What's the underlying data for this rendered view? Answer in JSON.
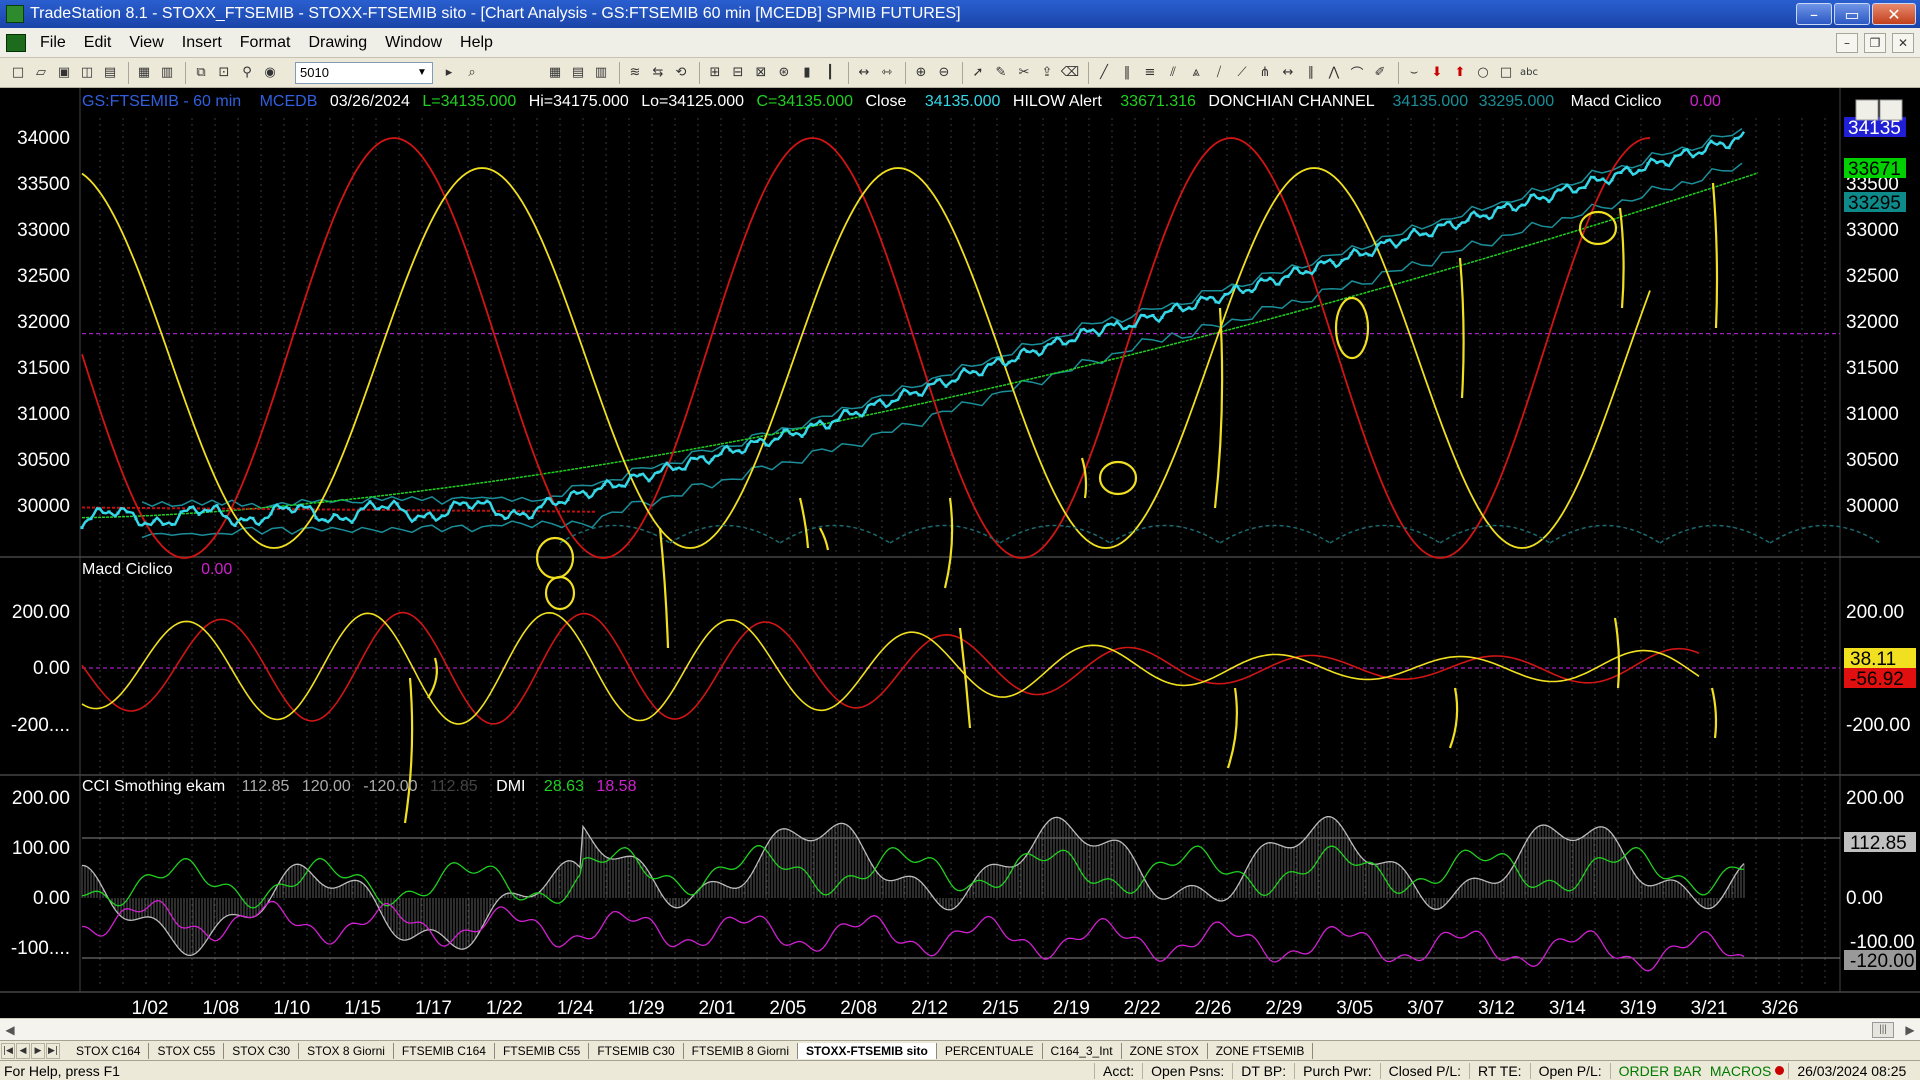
{
  "window": {
    "title": "TradeStation 8.1 - STOXX_FTSEMIB - STOXX-FTSEMIB sito - [Chart Analysis - GS:FTSEMIB  60 min  [MCEDB] SPMIB FUTURES]",
    "minimize": "–",
    "maximize": "▭",
    "close": "✕"
  },
  "menu": {
    "items": [
      "File",
      "Edit",
      "View",
      "Insert",
      "Format",
      "Drawing",
      "Window",
      "Help"
    ],
    "mdi": [
      "–",
      "❐",
      "✕"
    ]
  },
  "toolbar": {
    "symbol_value": "5010"
  },
  "chart": {
    "header": {
      "symbol": "GS:FTSEMIB - 60 min",
      "data": "MCEDB",
      "date": "03/26/2024",
      "last": "L=34135.000",
      "hi": "Hi=34175.000",
      "lo": "Lo=34125.000",
      "close_eq": "C=34135.000",
      "close_lbl": "Close",
      "close_val": "34135.000",
      "hilow_lbl": "HILOW Alert",
      "hilow_val": "33671.316",
      "donch_lbl": "DONCHIAN CHANNEL",
      "donch_hi": "34135.000",
      "donch_lo": "33295.000",
      "macd_lbl": "Macd Ciclico",
      "macd_val": "0.00"
    },
    "price_axis": [
      "34000",
      "33500",
      "33000",
      "32500",
      "32000",
      "31500",
      "31000",
      "30500",
      "30000"
    ],
    "price_axis_right": [
      "33500",
      "33000",
      "32500",
      "32000",
      "31500",
      "31000",
      "30500",
      "30000"
    ],
    "price_flags": {
      "last": "34135",
      "hilow": "33671",
      "donch_low": "33295"
    },
    "macd": {
      "label": "Macd Ciclico",
      "value": "0.00",
      "axis": [
        "200.00",
        "0.00",
        "-200...."
      ],
      "axis_right": [
        "200.00",
        "-200.00"
      ],
      "flag_yellow": "38.11",
      "flag_red": "-56.92"
    },
    "cci": {
      "label": "CCI Smothing ekam",
      "v1": "112.85",
      "v2": "120.00",
      "v3": "-120.00",
      "v4": "112.85",
      "dmi_lbl": "DMI",
      "dmi_plus": "28.63",
      "dmi_minus": "18.58",
      "axis": [
        "200.00",
        "100.00",
        "0.00",
        "-100...."
      ],
      "axis_right": [
        "200.00",
        "0.00"
      ],
      "flag_cci": "112.85",
      "flag_minus": "-120.00",
      "flag_hidden": "-100.00"
    },
    "dates": [
      "1/02",
      "1/08",
      "1/10",
      "1/15",
      "1/17",
      "1/22",
      "1/24",
      "1/29",
      "2/01",
      "2/05",
      "2/08",
      "2/12",
      "2/15",
      "2/19",
      "2/22",
      "2/26",
      "2/29",
      "3/05",
      "3/07",
      "3/12",
      "3/14",
      "3/19",
      "3/21",
      "3/26"
    ]
  },
  "tabs": [
    "STOX C164",
    "STOX C55",
    "STOX  C30",
    "STOX  8 Giorni",
    "FTSEMIB C164",
    "FTSEMIB C55",
    "FTSEMIB C30",
    "FTSEMIB  8 Giorni",
    "STOXX-FTSEMIB sito",
    "PERCENTUALE",
    "C164_3_Int",
    "ZONE STOX",
    "ZONE FTSEMIB"
  ],
  "active_tab": 8,
  "status": {
    "help": "For Help, press F1",
    "acct": "Acct:",
    "open_psns": "Open Psns:",
    "dt_bp": "DT BP:",
    "purch_pwr": "Purch Pwr:",
    "closed_pl": "Closed P/L:",
    "rt_te": "RT TE:",
    "open_pl": "Open P/L:",
    "order_bar": "ORDER BAR",
    "macros": "MACROS",
    "datetime": "26/03/2024 08:25"
  },
  "colors": {
    "price": "#35d8e8",
    "red": "#d01515",
    "yellow": "#f0e020",
    "green": "#20d020",
    "magenta": "#d020d0",
    "channel": "#1a8f9a",
    "hilow_flag": "#00d000",
    "donch_flag": "#0f8a8a",
    "last_flag": "#1f1fd6"
  }
}
